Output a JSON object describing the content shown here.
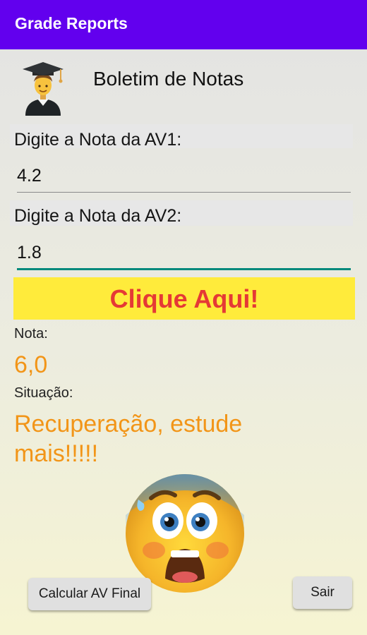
{
  "appbar": {
    "title": "Grade Reports"
  },
  "header": {
    "title": "Boletim de Notas",
    "avatar_icon": "graduate-icon"
  },
  "av1": {
    "label": "Digite a Nota da AV1:",
    "value": "4.2"
  },
  "av2": {
    "label": "Digite a Nota da AV2:",
    "value": "1.8"
  },
  "action": {
    "label": "Clique Aqui!"
  },
  "result": {
    "grade_label": "Nota:",
    "grade_value": "6,0",
    "status_label": "Situação:",
    "status_line1": "Recuperação, estude",
    "status_line2": "mais!!!!!",
    "emoji_icon": "scared-face-icon"
  },
  "buttons": {
    "calc_label": "Calcular AV Final",
    "exit_label": "Sair"
  },
  "colors": {
    "appbar": "#6200ee",
    "cta_bg": "#ffeb3b",
    "cta_text": "#e53935",
    "result": "#f29518",
    "focus": "#00897b"
  }
}
